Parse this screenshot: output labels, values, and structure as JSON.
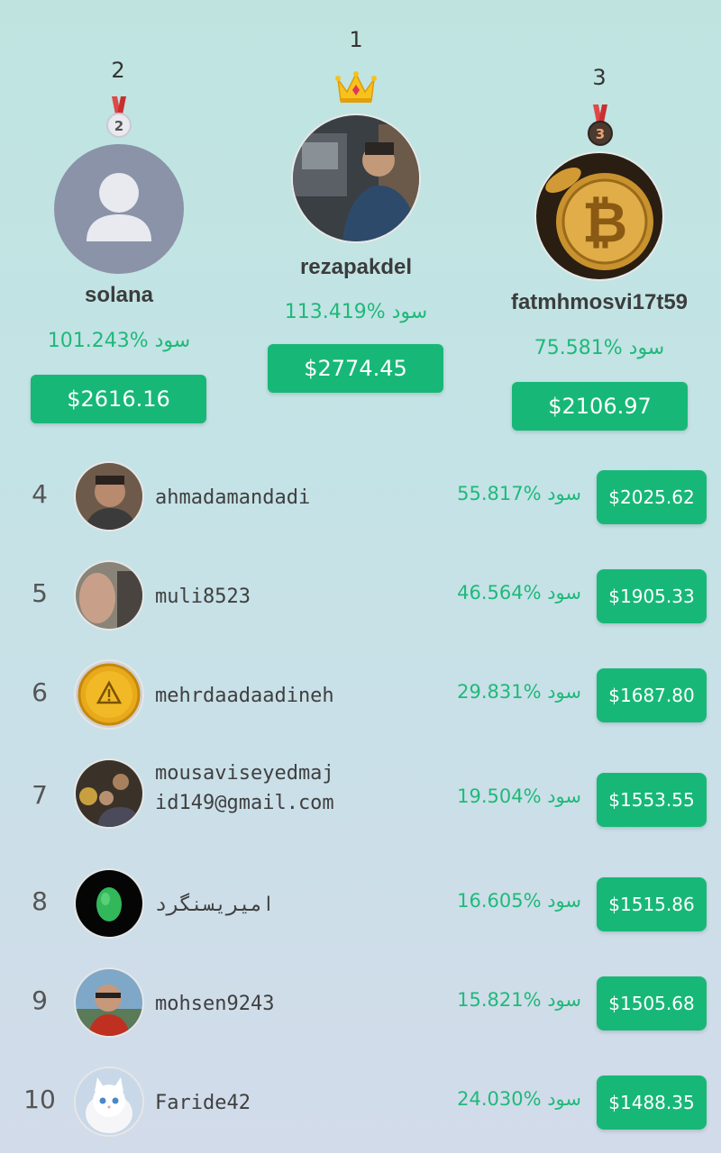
{
  "podium": {
    "first": {
      "rank": "1",
      "username": "rezapakdel",
      "profit": "113.419% سود",
      "amount": "$2774.45"
    },
    "second": {
      "rank": "2",
      "username": "solana",
      "profit": "101.243% سود",
      "amount": "$2616.16"
    },
    "third": {
      "rank": "3",
      "username": "fatmhmosvi17t59",
      "profit": "75.581% سود",
      "amount": "$2106.97"
    },
    "medal_second_label": "2",
    "medal_third_label": "3"
  },
  "list": [
    {
      "rank": "4",
      "username": "ahmadamandadi",
      "profit": "55.817% سود",
      "amount": "$2025.62"
    },
    {
      "rank": "5",
      "username": "muli8523",
      "profit": "46.564% سود",
      "amount": "$1905.33"
    },
    {
      "rank": "6",
      "username": "mehrdaadaadineh",
      "profit": "29.831% سود",
      "amount": "$1687.80"
    },
    {
      "rank": "7",
      "username": "mousaviseyedmajid149@gmail.com",
      "profit": "19.504% سود",
      "amount": "$1553.55"
    },
    {
      "rank": "8",
      "username": "امیریسنگرد",
      "profit": "16.605% سود",
      "amount": "$1515.86"
    },
    {
      "rank": "9",
      "username": "mohsen9243",
      "profit": "15.821% سود",
      "amount": "$1505.68"
    },
    {
      "rank": "10",
      "username": "Faride42",
      "profit": "24.030% سود",
      "amount": "$1488.35"
    }
  ],
  "colors": {
    "accent": "#17b877",
    "profit_text": "#1fb97a",
    "placeholder_avatar": "#8b93a8"
  }
}
